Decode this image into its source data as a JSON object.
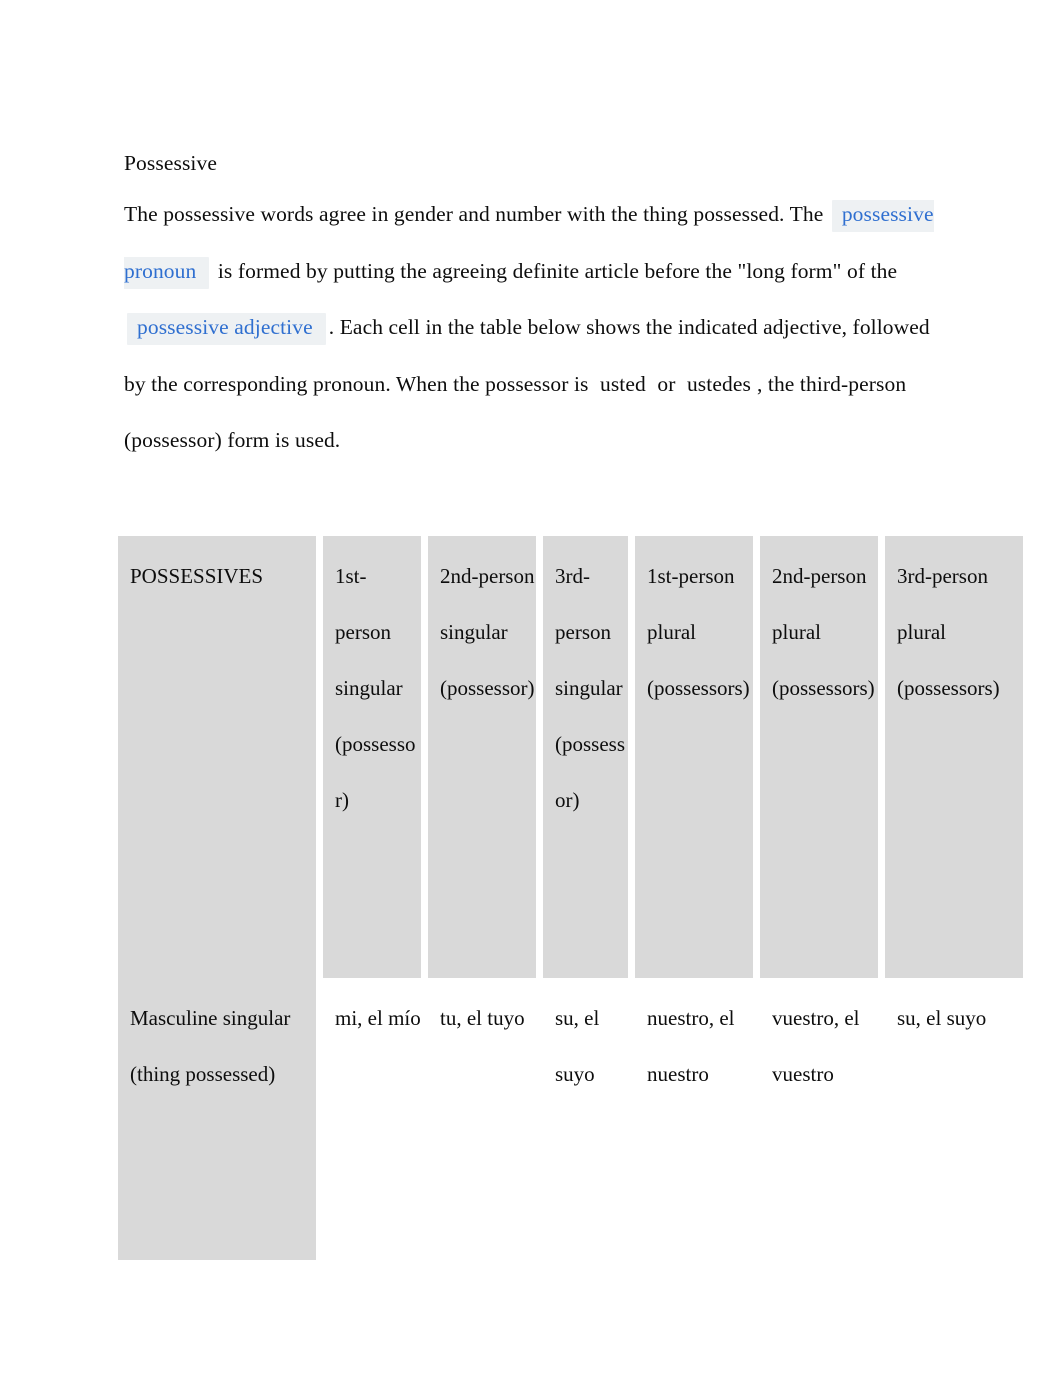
{
  "document": {
    "heading": "Possessive",
    "paragraph": {
      "segment_1": "The possessive words agree in gender and number with the thing possessed. The ",
      "link_1": "possessive pronoun",
      "segment_2": " is formed by putting the agreeing definite article before the \"long form\" of the ",
      "link_2": "possessive adjective",
      "segment_3": ". Each cell in the table below shows the indicated adjective, followed by the corresponding pronoun. When the possessor is ",
      "term_1": "usted",
      "segment_4": " or ",
      "term_2": "ustedes",
      "segment_5": ", the third-person (possessor) form is used."
    }
  },
  "table": {
    "headers": [
      "POSSESSIVES",
      "1st-person singular (possessor)",
      "2nd-person singular (possessor)",
      "3rd-person singular (possessor)",
      "1st-person plural (possessors)",
      "2nd-person plural (possessors)",
      "3rd-person plural (possessors)"
    ],
    "rows": [
      {
        "label": "Masculine singular (thing possessed)",
        "cells": [
          "mi, el mío",
          "tu, el tuyo",
          "su, el suyo",
          "nuestro, el nuestro",
          "vuestro, el vuestro",
          "su, el suyo"
        ]
      }
    ]
  },
  "colors": {
    "header_background": "#d9d9d9",
    "cell_background": "#ffffff",
    "link_color": "#2f6fd0",
    "link_highlight": "#eef1f3",
    "text_color": "#0d0d0d"
  }
}
